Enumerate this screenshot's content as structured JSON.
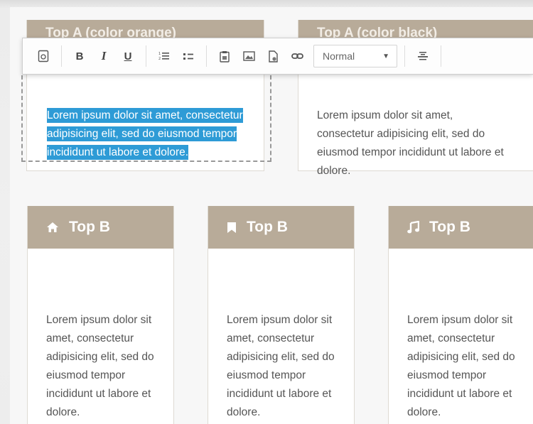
{
  "top_a_left": {
    "title": "Top A (color orange)",
    "body": "Lorem ipsum dolor sit amet, consectetur adipisicing elit, sed do eiusmod tempor incididunt ut labore et dolore."
  },
  "top_a_right": {
    "title": "Top A (color black)",
    "body": "Lorem ipsum dolor sit amet, consectetur adipisicing elit, sed do eiusmod tempor incididunt ut labore et dolore."
  },
  "toolbar": {
    "bold_label": "B",
    "italic_label": "I",
    "underline_label": "U",
    "format_select_value": "Normal"
  },
  "top_b_cards": [
    {
      "icon": "home-icon",
      "title": "Top B",
      "body": "Lorem ipsum dolor sit amet, consectetur adipisicing elit, sed do eiusmod tempor incididunt ut labore et dolore."
    },
    {
      "icon": "bookmark-icon",
      "title": "Top B",
      "body": "Lorem ipsum dolor sit amet, consectetur adipisicing elit, sed do eiusmod tempor incididunt ut labore et dolore."
    },
    {
      "icon": "music-note-icon",
      "title": "Top B",
      "body": "Lorem ipsum dolor sit amet, consectetur adipisicing elit, sed do eiusmod tempor incididunt ut labore et dolore."
    }
  ],
  "colors": {
    "header_bg": "#b8ab99",
    "selection_highlight": "#2e9bd6",
    "body_text": "#555555"
  }
}
